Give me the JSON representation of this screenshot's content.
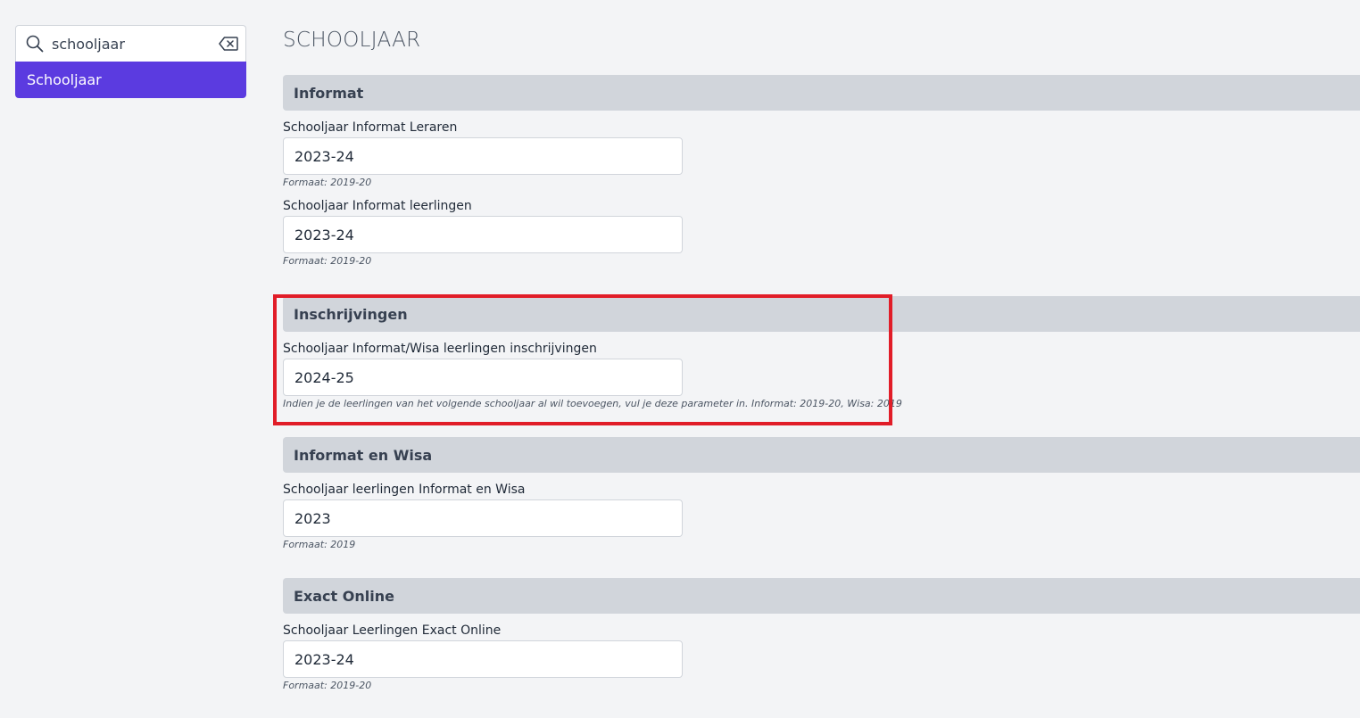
{
  "search": {
    "value": "schooljaar",
    "icon": "search-icon",
    "clear_icon": "backspace-icon"
  },
  "results": [
    {
      "label": "Schooljaar",
      "selected": true
    }
  ],
  "page": {
    "title": "SCHOOLJAAR"
  },
  "sections": [
    {
      "title": "Informat",
      "fields": [
        {
          "label": "Schooljaar Informat Leraren",
          "value": "2023-24",
          "help": "Formaat: 2019-20"
        },
        {
          "label": "Schooljaar Informat leerlingen",
          "value": "2023-24",
          "help": "Formaat: 2019-20"
        }
      ]
    },
    {
      "title": "Inschrijvingen",
      "fields": [
        {
          "label": "Schooljaar Informat/Wisa leerlingen inschrijvingen",
          "value": "2024-25",
          "help": "Indien je de leerlingen van het volgende schooljaar al wil toevoegen, vul je deze parameter in. Informat: 2019-20, Wisa: 2019"
        }
      ]
    },
    {
      "title": "Informat en Wisa",
      "fields": [
        {
          "label": "Schooljaar leerlingen Informat en Wisa",
          "value": "2023",
          "help": "Formaat: 2019"
        }
      ]
    },
    {
      "title": "Exact Online",
      "fields": [
        {
          "label": "Schooljaar Leerlingen Exact Online",
          "value": "2023-24",
          "help": "Formaat: 2019-20"
        }
      ]
    }
  ],
  "colors": {
    "accent": "#5b3be0",
    "highlight": "#e11d28",
    "section_bg": "#d1d5db",
    "page_bg": "#f3f4f6"
  }
}
